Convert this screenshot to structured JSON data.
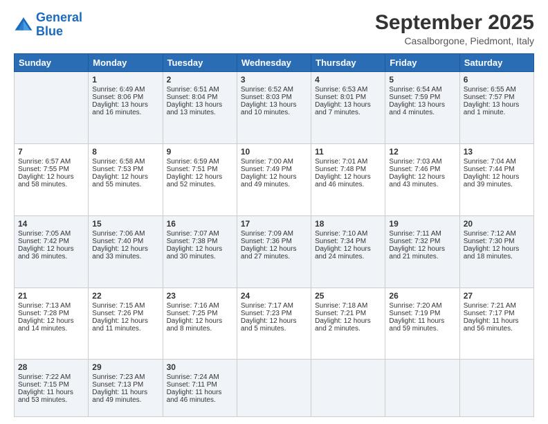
{
  "logo": {
    "line1": "General",
    "line2": "Blue"
  },
  "title": "September 2025",
  "location": "Casalborgone, Piedmont, Italy",
  "days_of_week": [
    "Sunday",
    "Monday",
    "Tuesday",
    "Wednesday",
    "Thursday",
    "Friday",
    "Saturday"
  ],
  "weeks": [
    [
      {
        "day": "",
        "info": ""
      },
      {
        "day": "1",
        "info": "Sunrise: 6:49 AM\nSunset: 8:06 PM\nDaylight: 13 hours\nand 16 minutes."
      },
      {
        "day": "2",
        "info": "Sunrise: 6:51 AM\nSunset: 8:04 PM\nDaylight: 13 hours\nand 13 minutes."
      },
      {
        "day": "3",
        "info": "Sunrise: 6:52 AM\nSunset: 8:03 PM\nDaylight: 13 hours\nand 10 minutes."
      },
      {
        "day": "4",
        "info": "Sunrise: 6:53 AM\nSunset: 8:01 PM\nDaylight: 13 hours\nand 7 minutes."
      },
      {
        "day": "5",
        "info": "Sunrise: 6:54 AM\nSunset: 7:59 PM\nDaylight: 13 hours\nand 4 minutes."
      },
      {
        "day": "6",
        "info": "Sunrise: 6:55 AM\nSunset: 7:57 PM\nDaylight: 13 hours\nand 1 minute."
      }
    ],
    [
      {
        "day": "7",
        "info": "Sunrise: 6:57 AM\nSunset: 7:55 PM\nDaylight: 12 hours\nand 58 minutes."
      },
      {
        "day": "8",
        "info": "Sunrise: 6:58 AM\nSunset: 7:53 PM\nDaylight: 12 hours\nand 55 minutes."
      },
      {
        "day": "9",
        "info": "Sunrise: 6:59 AM\nSunset: 7:51 PM\nDaylight: 12 hours\nand 52 minutes."
      },
      {
        "day": "10",
        "info": "Sunrise: 7:00 AM\nSunset: 7:49 PM\nDaylight: 12 hours\nand 49 minutes."
      },
      {
        "day": "11",
        "info": "Sunrise: 7:01 AM\nSunset: 7:48 PM\nDaylight: 12 hours\nand 46 minutes."
      },
      {
        "day": "12",
        "info": "Sunrise: 7:03 AM\nSunset: 7:46 PM\nDaylight: 12 hours\nand 43 minutes."
      },
      {
        "day": "13",
        "info": "Sunrise: 7:04 AM\nSunset: 7:44 PM\nDaylight: 12 hours\nand 39 minutes."
      }
    ],
    [
      {
        "day": "14",
        "info": "Sunrise: 7:05 AM\nSunset: 7:42 PM\nDaylight: 12 hours\nand 36 minutes."
      },
      {
        "day": "15",
        "info": "Sunrise: 7:06 AM\nSunset: 7:40 PM\nDaylight: 12 hours\nand 33 minutes."
      },
      {
        "day": "16",
        "info": "Sunrise: 7:07 AM\nSunset: 7:38 PM\nDaylight: 12 hours\nand 30 minutes."
      },
      {
        "day": "17",
        "info": "Sunrise: 7:09 AM\nSunset: 7:36 PM\nDaylight: 12 hours\nand 27 minutes."
      },
      {
        "day": "18",
        "info": "Sunrise: 7:10 AM\nSunset: 7:34 PM\nDaylight: 12 hours\nand 24 minutes."
      },
      {
        "day": "19",
        "info": "Sunrise: 7:11 AM\nSunset: 7:32 PM\nDaylight: 12 hours\nand 21 minutes."
      },
      {
        "day": "20",
        "info": "Sunrise: 7:12 AM\nSunset: 7:30 PM\nDaylight: 12 hours\nand 18 minutes."
      }
    ],
    [
      {
        "day": "21",
        "info": "Sunrise: 7:13 AM\nSunset: 7:28 PM\nDaylight: 12 hours\nand 14 minutes."
      },
      {
        "day": "22",
        "info": "Sunrise: 7:15 AM\nSunset: 7:26 PM\nDaylight: 12 hours\nand 11 minutes."
      },
      {
        "day": "23",
        "info": "Sunrise: 7:16 AM\nSunset: 7:25 PM\nDaylight: 12 hours\nand 8 minutes."
      },
      {
        "day": "24",
        "info": "Sunrise: 7:17 AM\nSunset: 7:23 PM\nDaylight: 12 hours\nand 5 minutes."
      },
      {
        "day": "25",
        "info": "Sunrise: 7:18 AM\nSunset: 7:21 PM\nDaylight: 12 hours\nand 2 minutes."
      },
      {
        "day": "26",
        "info": "Sunrise: 7:20 AM\nSunset: 7:19 PM\nDaylight: 11 hours\nand 59 minutes."
      },
      {
        "day": "27",
        "info": "Sunrise: 7:21 AM\nSunset: 7:17 PM\nDaylight: 11 hours\nand 56 minutes."
      }
    ],
    [
      {
        "day": "28",
        "info": "Sunrise: 7:22 AM\nSunset: 7:15 PM\nDaylight: 11 hours\nand 53 minutes."
      },
      {
        "day": "29",
        "info": "Sunrise: 7:23 AM\nSunset: 7:13 PM\nDaylight: 11 hours\nand 49 minutes."
      },
      {
        "day": "30",
        "info": "Sunrise: 7:24 AM\nSunset: 7:11 PM\nDaylight: 11 hours\nand 46 minutes."
      },
      {
        "day": "",
        "info": ""
      },
      {
        "day": "",
        "info": ""
      },
      {
        "day": "",
        "info": ""
      },
      {
        "day": "",
        "info": ""
      }
    ]
  ]
}
